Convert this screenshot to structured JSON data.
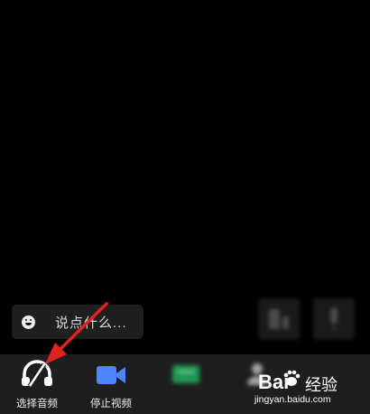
{
  "comment": {
    "placeholder": "说点什么..."
  },
  "toolbar": {
    "items": [
      {
        "label": "选择音频",
        "icon": "headphone-mute-icon"
      },
      {
        "label": "停止视频",
        "icon": "video-camera-icon"
      },
      {
        "label": "",
        "icon": "screen-share-icon"
      },
      {
        "label": "",
        "icon": "participants-icon"
      }
    ]
  },
  "watermark": {
    "brand": "Bai",
    "tail": "经验",
    "url": "jingyan.baidu.com"
  },
  "colors": {
    "accent_blue": "#4f84ff",
    "share_green": "#1fae5a",
    "arrow_red": "#e4211c",
    "toolbar_bg": "#1e1e1e"
  }
}
